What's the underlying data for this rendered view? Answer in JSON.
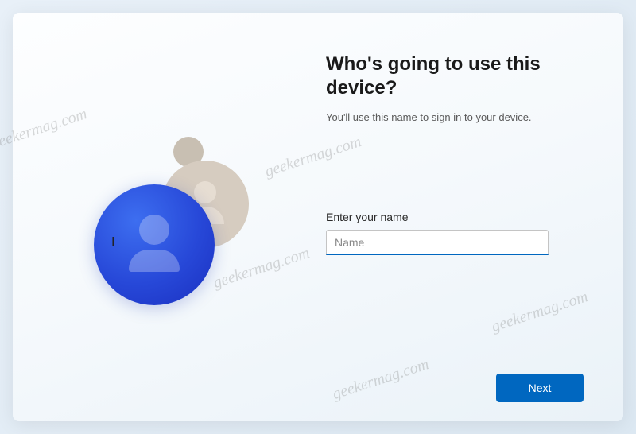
{
  "setup": {
    "title": "Who's going to use this device?",
    "subtitle": "You'll use this name to sign in to your device.",
    "name_field": {
      "label": "Enter your name",
      "placeholder": "Name",
      "value": ""
    },
    "next_button_label": "Next"
  },
  "watermark": {
    "text": "geekermag.com"
  }
}
